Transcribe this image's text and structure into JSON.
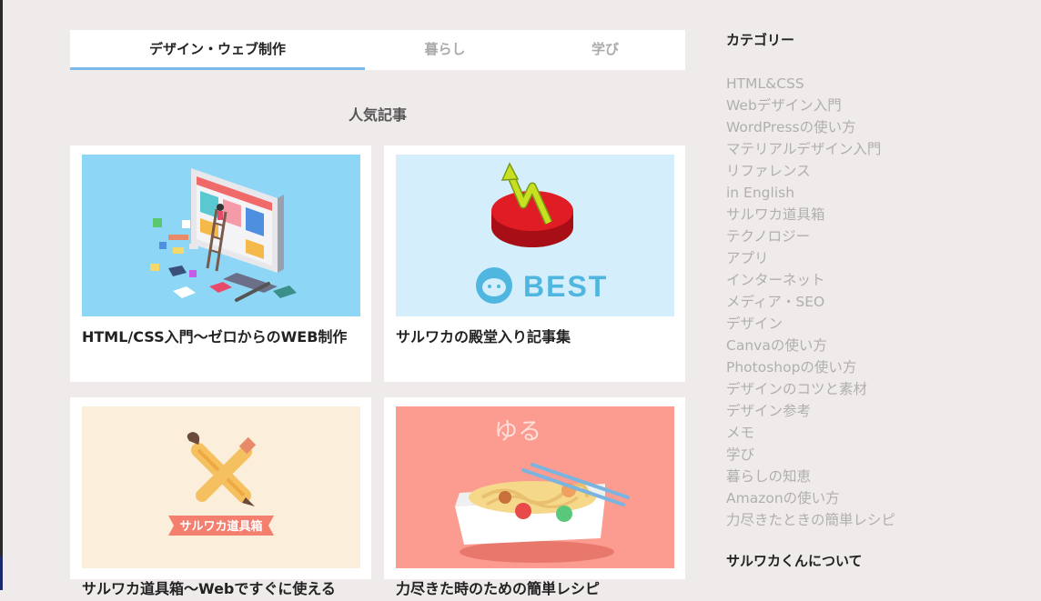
{
  "tabs": [
    {
      "label": "デザイン・ウェブ制作",
      "active": true
    },
    {
      "label": "暮らし",
      "active": false
    },
    {
      "label": "学び",
      "active": false
    }
  ],
  "section_title": "人気記事",
  "cards": [
    {
      "title": "HTML/CSS入門〜ゼロからのWEB制作",
      "thumb_bg": "#8ed6f5",
      "thumb_icon": "computer-illustration"
    },
    {
      "title": "サルワカの殿堂入り記事集",
      "thumb_bg": "#d4eefb",
      "thumb_icon": "best-badge-illustration",
      "thumb_text": "BEST"
    },
    {
      "title": "サルワカ道具箱〜Webですぐに使える",
      "thumb_bg": "#fbefdc",
      "thumb_icon": "tools-illustration",
      "thumb_text": "サルワカ道具箱"
    },
    {
      "title": "力尽きた時のための簡単レシピ",
      "thumb_bg": "#fc9b8f",
      "thumb_icon": "noodle-bowl-illustration",
      "thumb_text": "ゆる"
    }
  ],
  "sidebar": {
    "category_heading": "カテゴリー",
    "categories": [
      "HTML&CSS",
      "Webデザイン入門",
      "WordPressの使い方",
      "マテリアルデザイン入門",
      "リファレンス",
      "in English",
      "サルワカ道具箱",
      "テクノロジー",
      "アプリ",
      "インターネット",
      "メディア・SEO",
      "デザイン",
      "Canvaの使い方",
      "Photoshopの使い方",
      "デザインのコツと素材",
      "デザイン参考",
      "メモ",
      "学び",
      "暮らしの知恵",
      "Amazonの使い方",
      "力尽きたときの簡単レシピ"
    ],
    "about_heading": "サルワカくんについて"
  },
  "colors": {
    "background": "#efebea",
    "tab_accent": "#7cb8ea",
    "category_text": "#b1afae"
  }
}
